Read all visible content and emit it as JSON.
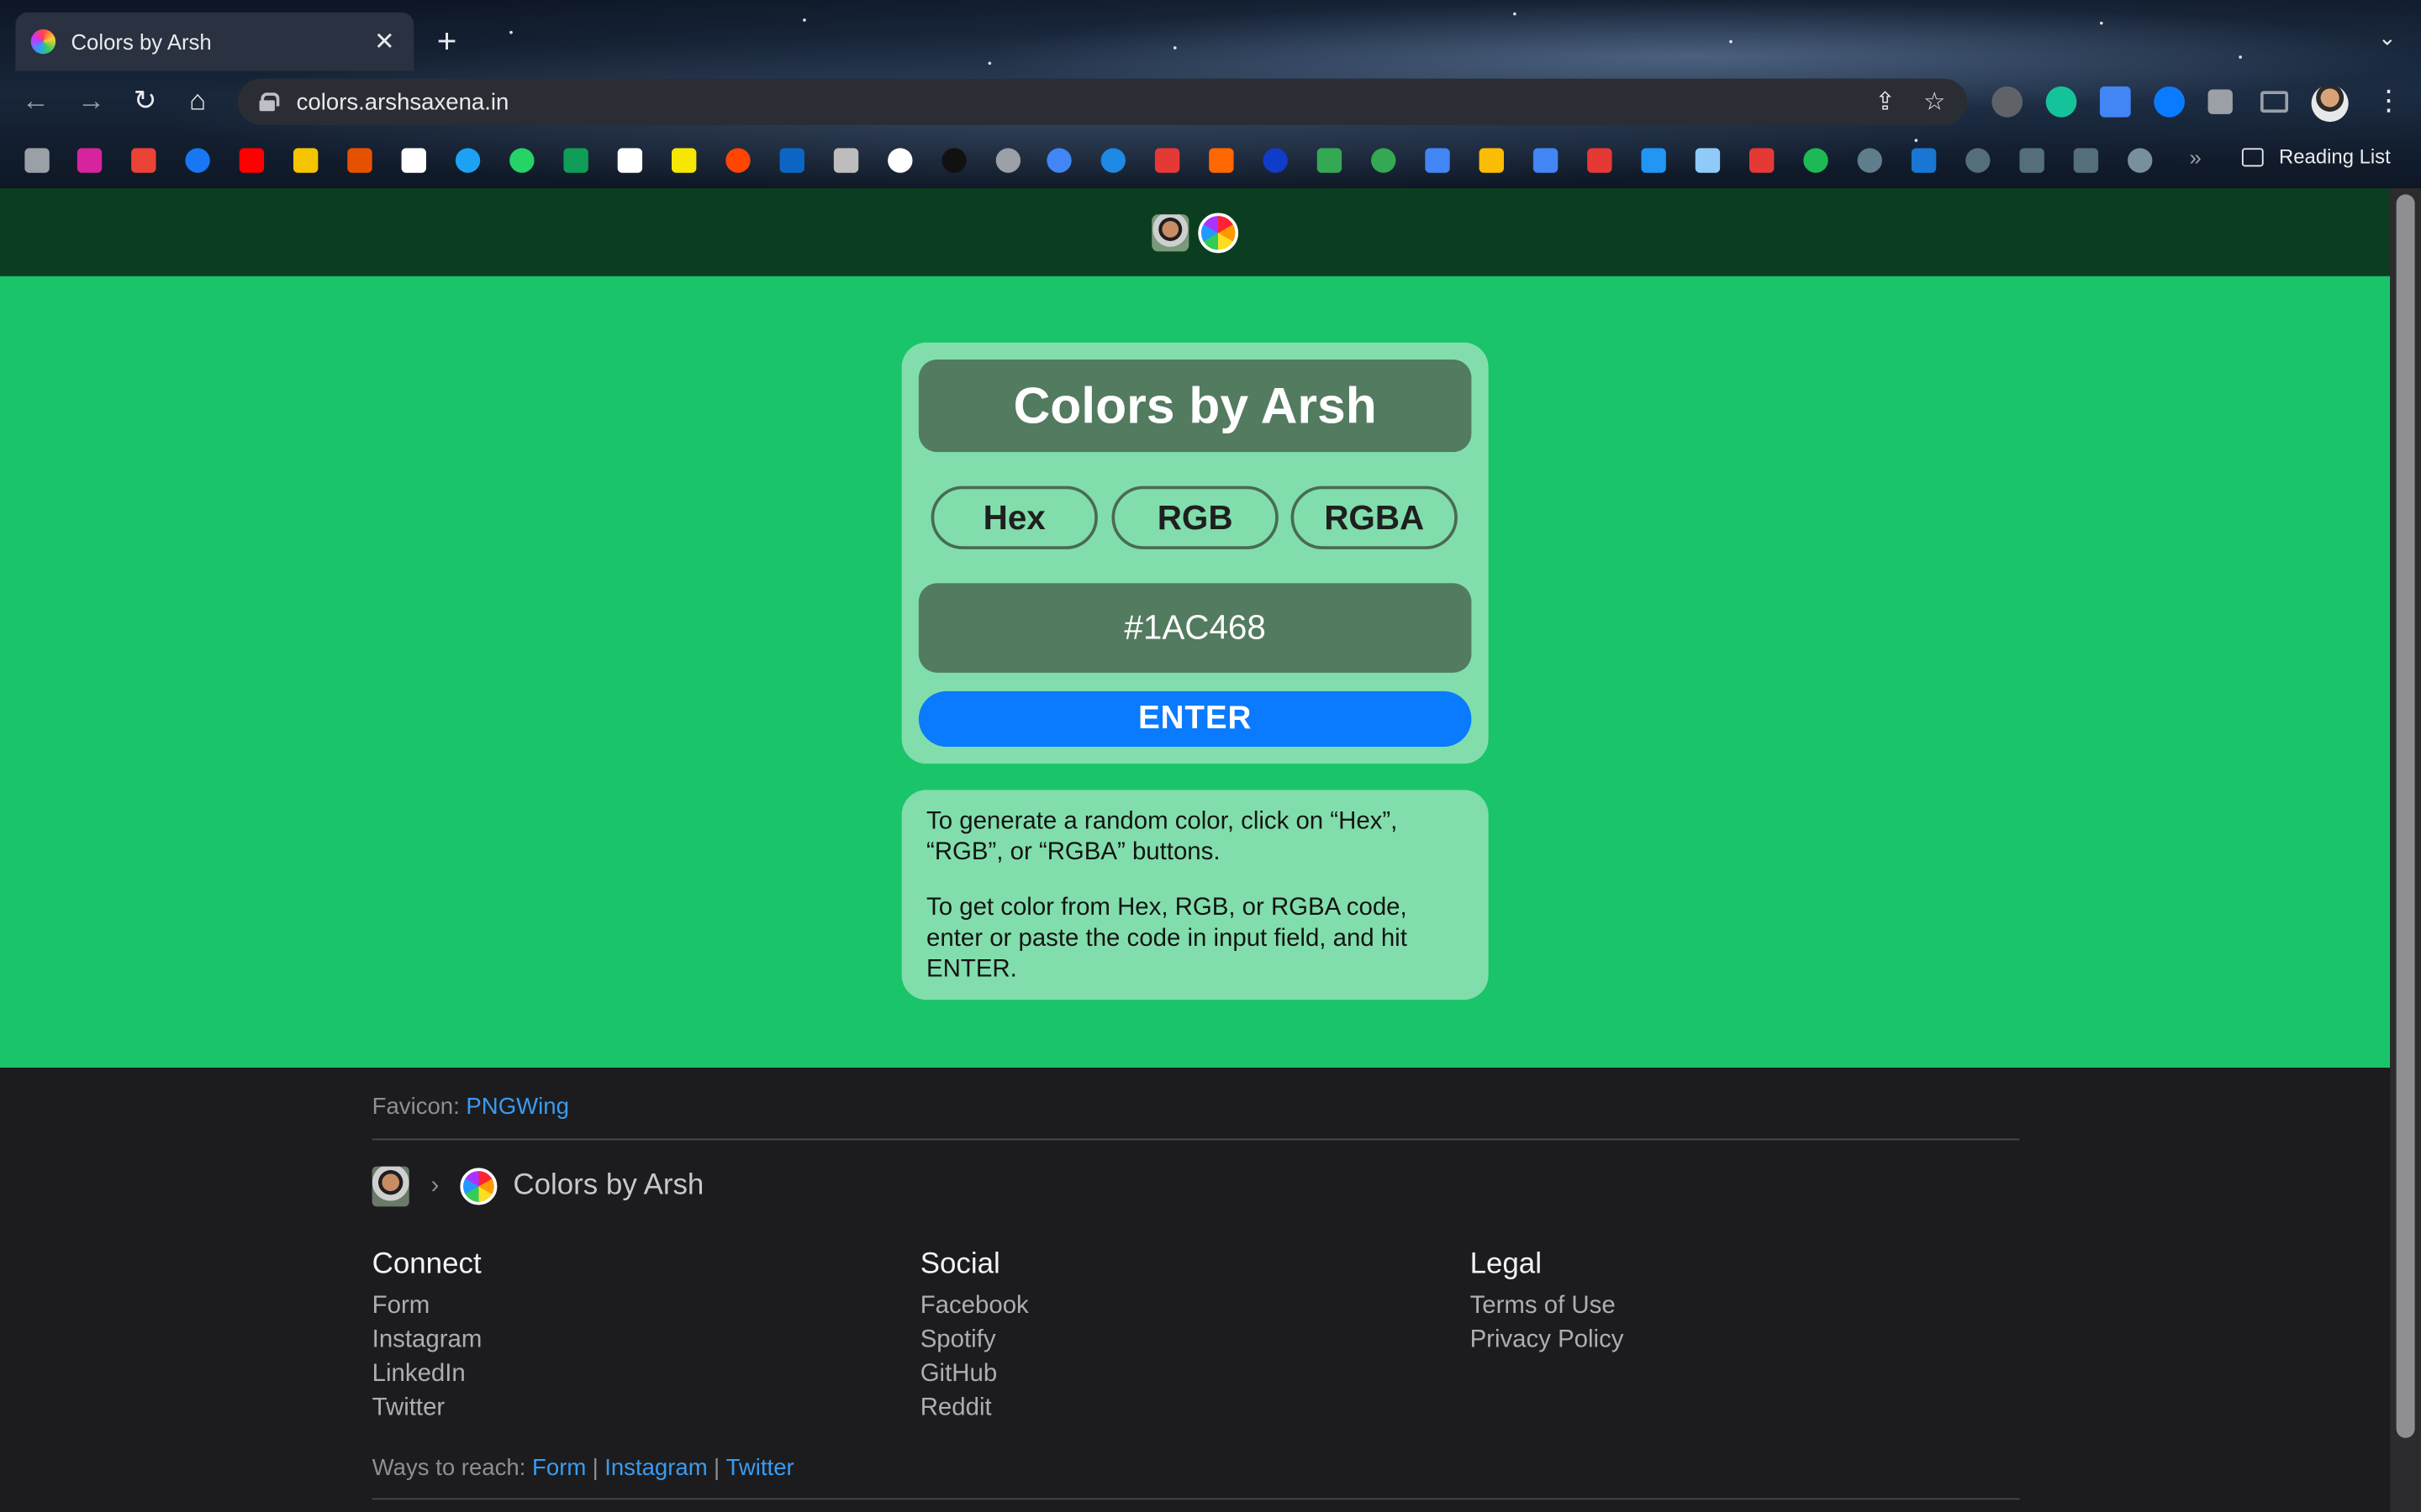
{
  "browser": {
    "tab_title": "Colors by Arsh",
    "tab_close": "✕",
    "new_tab": "+",
    "url": "colors.arshsaxena.in",
    "reading_list": "Reading List",
    "overflow": "»"
  },
  "site": {
    "colors": {
      "page_bg": "#1ac468",
      "topbar_bg": "#0b3e21",
      "title_bg": "#537b5f",
      "enter_bg": "#0a7aff"
    }
  },
  "card": {
    "title": "Colors by Arsh",
    "modes": [
      "Hex",
      "RGB",
      "RGBA"
    ],
    "input_value": "#1AC468",
    "enter_label": "ENTER"
  },
  "help": {
    "line1": "To generate a random color, click on “Hex”, “RGB”, or “RGBA” buttons.",
    "line2": "To get color from Hex, RGB, or RGBA code, enter or paste the code in input field, and hit ENTER."
  },
  "footer": {
    "favicon_label": "Favicon: ",
    "favicon_link": "PNGWing",
    "breadcrumb_sep": "›",
    "breadcrumb_title": "Colors by Arsh",
    "columns": [
      {
        "title": "Connect",
        "links": [
          "Form",
          "Instagram",
          "LinkedIn",
          "Twitter"
        ]
      },
      {
        "title": "Social",
        "links": [
          "Facebook",
          "Spotify",
          "GitHub",
          "Reddit"
        ]
      },
      {
        "title": "Legal",
        "links": [
          "Terms of Use",
          "Privacy Policy"
        ]
      }
    ],
    "reach_label": "Ways to reach: ",
    "reach_links": [
      "Form",
      "Instagram",
      "Twitter"
    ],
    "reach_sep": "|"
  }
}
